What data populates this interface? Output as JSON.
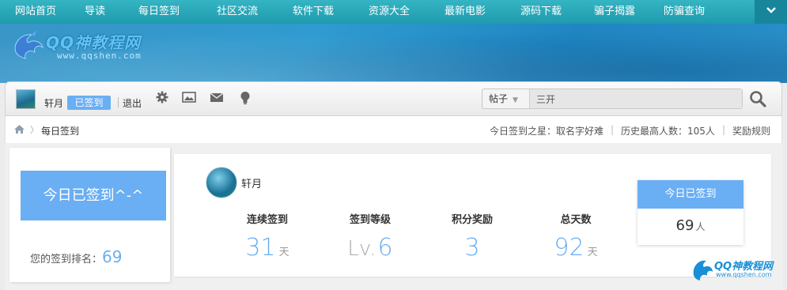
{
  "nav": {
    "items": [
      "网站首页",
      "导读",
      "每日签到",
      "社区交流",
      "软件下载",
      "资源大全",
      "最新电影",
      "源码下载",
      "骗子揭露",
      "防骗查询"
    ],
    "more_icon": "chevron-down-icon"
  },
  "logo": {
    "name": "QQ神教程网",
    "url": "www.qqshen.com"
  },
  "toolbar": {
    "username": "轩月",
    "signed_badge": "已签到",
    "logout": "退出",
    "icons": [
      "gear-icon",
      "image-icon",
      "mail-icon",
      "lightbulb-icon"
    ],
    "search_type": "帖子",
    "search_value": "三开",
    "search_icon": "search-icon"
  },
  "breadcrumb": {
    "home_icon": "home-icon",
    "page": "每日签到",
    "star": "今日签到之星：取名字好难",
    "history": "历史最高人数：105人",
    "rules": "奖励规则"
  },
  "left": {
    "signed_button": "今日已签到^-^",
    "rank_label": "您的签到排名：",
    "rank_value": "69"
  },
  "main": {
    "username": "轩月",
    "stats": [
      {
        "label": "连续签到",
        "prefix": "",
        "value": "31",
        "unit": "天"
      },
      {
        "label": "签到等级",
        "prefix": "Lv.",
        "value": "6",
        "unit": ""
      },
      {
        "label": "积分奖励",
        "prefix": "",
        "value": "3",
        "unit": ""
      },
      {
        "label": "总天数",
        "prefix": "",
        "value": "92",
        "unit": "天"
      }
    ]
  },
  "today": {
    "title": "今日已签到",
    "count": "69",
    "unit": "人"
  },
  "watermark": {
    "name": "QQ神教程网",
    "url": "www.qqshen.com"
  },
  "colors": {
    "accent": "#6aaef3",
    "nav": "#2aa7b6",
    "banner": "#2f9bd0"
  }
}
